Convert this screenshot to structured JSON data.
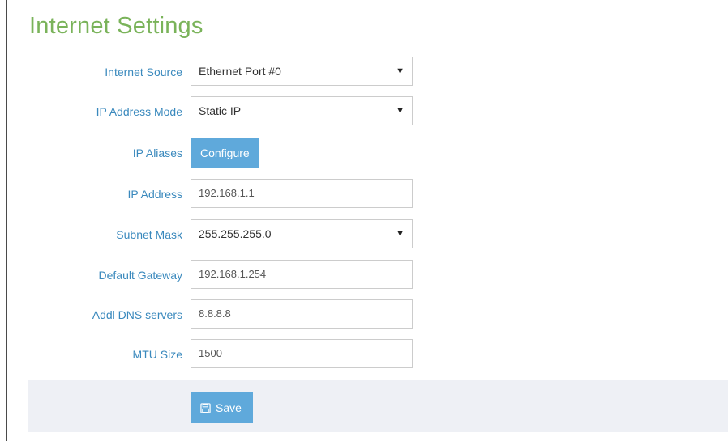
{
  "title": "Internet Settings",
  "form": {
    "internet_source": {
      "label": "Internet Source",
      "value": "Ethernet Port #0"
    },
    "ip_address_mode": {
      "label": "IP Address Mode",
      "value": "Static IP"
    },
    "ip_aliases": {
      "label": "IP Aliases",
      "button": "Configure"
    },
    "ip_address": {
      "label": "IP Address",
      "value": "192.168.1.1"
    },
    "subnet_mask": {
      "label": "Subnet Mask",
      "value": "255.255.255.0"
    },
    "default_gateway": {
      "label": "Default Gateway",
      "value": "192.168.1.254"
    },
    "addl_dns": {
      "label": "Addl DNS servers",
      "value": "8.8.8.8"
    },
    "mtu_size": {
      "label": "MTU Size",
      "value": "1500"
    }
  },
  "footer": {
    "save_label": "Save",
    "save_icon": "floppy-disk-icon"
  },
  "colors": {
    "title": "#7ab35a",
    "label": "#3a89bd",
    "button": "#5fa9db",
    "footer_bg": "#eef0f5"
  }
}
